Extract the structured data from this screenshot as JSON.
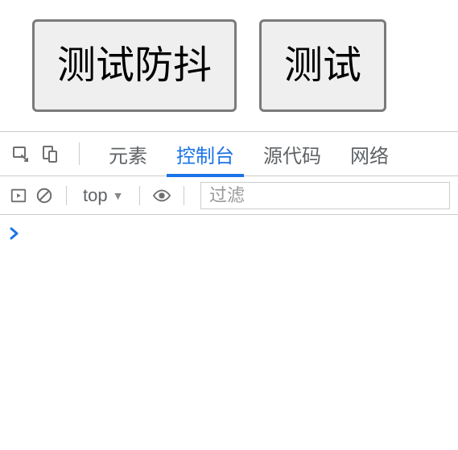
{
  "page": {
    "button1_label": "测试防抖",
    "button2_label": "测试"
  },
  "devtools": {
    "tabs": {
      "elements": "元素",
      "console": "控制台",
      "sources": "源代码",
      "network": "网络"
    },
    "toolbar": {
      "context_label": "top",
      "filter_placeholder": "过滤"
    }
  }
}
